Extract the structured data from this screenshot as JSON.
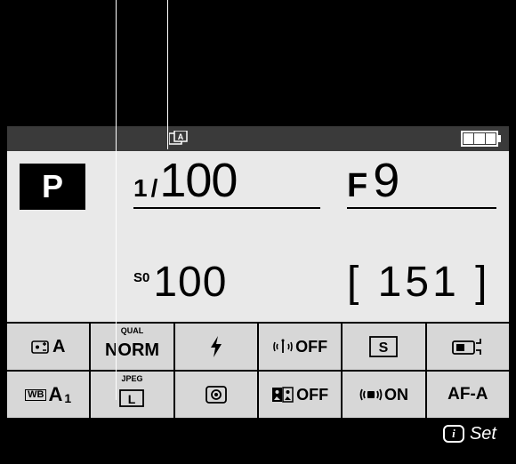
{
  "mode": "P",
  "shutter": {
    "numerator": "1",
    "denominator": "100"
  },
  "aperture": {
    "prefix": "F",
    "value": "9"
  },
  "iso": {
    "label": "S0",
    "value": "100"
  },
  "remaining": "[ 151 ]",
  "grid": {
    "r1c1": {
      "icon": "exposure-comp",
      "value": "A"
    },
    "r1c2": {
      "label": "QUAL",
      "value": "NORM"
    },
    "r1c3": {
      "icon": "flash"
    },
    "r1c4": {
      "icon": "wireless",
      "value": "OFF"
    },
    "r1c5": {
      "icon": "af-area-single",
      "value": "S"
    },
    "r1c6": {
      "icon": "bracket"
    },
    "r2c1": {
      "icon": "wb",
      "value": "A1"
    },
    "r2c2": {
      "label": "JPEG",
      "icon": "size-l",
      "value": "L"
    },
    "r2c3": {
      "icon": "metering"
    },
    "r2c4": {
      "icon": "active-d",
      "value": "OFF"
    },
    "r2c5": {
      "icon": "vr",
      "value": "ON"
    },
    "r2c6": {
      "value": "AF-A"
    }
  },
  "iset": "Set",
  "status": {
    "picture_control": "A"
  }
}
